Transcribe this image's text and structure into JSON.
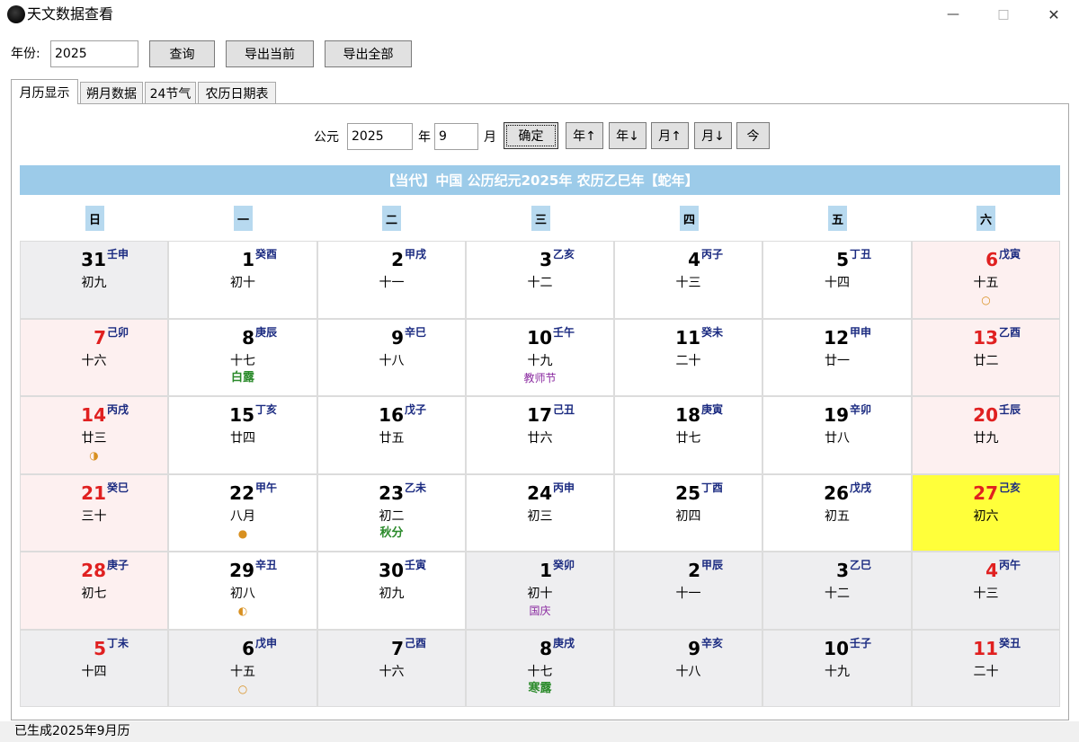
{
  "window": {
    "title": "天文数据查看",
    "minimize": "—",
    "maximize": "□",
    "close": "✕"
  },
  "toolbar": {
    "year_label": "年份:",
    "year_value": "2025",
    "query": "查询",
    "export_current": "导出当前",
    "export_all": "导出全部"
  },
  "tabs": [
    {
      "label": "月历显示",
      "active": true
    },
    {
      "label": "朔月数据",
      "active": false
    },
    {
      "label": "24节气",
      "active": false
    },
    {
      "label": "农历日期表",
      "active": false
    }
  ],
  "nav": {
    "ce_label": "公元",
    "year_value": "2025",
    "year_suffix": "年",
    "month_value": "9",
    "month_suffix": "月",
    "ok": "确定",
    "year_up": "年↑",
    "year_down": "年↓",
    "month_up": "月↑",
    "month_down": "月↓",
    "today": "今"
  },
  "banner": "【当代】中国 公历纪元2025年 农历乙巳年【蛇年】",
  "weekdays": [
    "日",
    "一",
    "二",
    "三",
    "四",
    "五",
    "六"
  ],
  "days": [
    {
      "solar": "31",
      "gz": "壬申",
      "lunar": "初九",
      "extra": "",
      "kind": "othermonth"
    },
    {
      "solar": "1",
      "gz": "癸酉",
      "lunar": "初十",
      "extra": "",
      "kind": "normal"
    },
    {
      "solar": "2",
      "gz": "甲戌",
      "lunar": "十一",
      "extra": "",
      "kind": "normal"
    },
    {
      "solar": "3",
      "gz": "乙亥",
      "lunar": "十二",
      "extra": "",
      "kind": "normal"
    },
    {
      "solar": "4",
      "gz": "丙子",
      "lunar": "十三",
      "extra": "",
      "kind": "normal"
    },
    {
      "solar": "5",
      "gz": "丁丑",
      "lunar": "十四",
      "extra": "",
      "kind": "normal"
    },
    {
      "solar": "6",
      "gz": "戊寅",
      "lunar": "十五",
      "extra": "○",
      "extra_type": "moon",
      "kind": "weekend"
    },
    {
      "solar": "7",
      "gz": "己卯",
      "lunar": "十六",
      "extra": "",
      "kind": "weekend"
    },
    {
      "solar": "8",
      "gz": "庚辰",
      "lunar": "十七",
      "extra": "白露",
      "extra_type": "term",
      "kind": "normal"
    },
    {
      "solar": "9",
      "gz": "辛巳",
      "lunar": "十八",
      "extra": "",
      "kind": "normal"
    },
    {
      "solar": "10",
      "gz": "壬午",
      "lunar": "十九",
      "extra": "教师节",
      "extra_type": "fest",
      "kind": "normal"
    },
    {
      "solar": "11",
      "gz": "癸未",
      "lunar": "二十",
      "extra": "",
      "kind": "normal"
    },
    {
      "solar": "12",
      "gz": "甲申",
      "lunar": "廿一",
      "extra": "",
      "kind": "normal"
    },
    {
      "solar": "13",
      "gz": "乙酉",
      "lunar": "廿二",
      "extra": "",
      "kind": "weekend"
    },
    {
      "solar": "14",
      "gz": "丙戌",
      "lunar": "廿三",
      "extra": "◑",
      "extra_type": "moon",
      "kind": "weekend"
    },
    {
      "solar": "15",
      "gz": "丁亥",
      "lunar": "廿四",
      "extra": "",
      "kind": "normal"
    },
    {
      "solar": "16",
      "gz": "戊子",
      "lunar": "廿五",
      "extra": "",
      "kind": "normal"
    },
    {
      "solar": "17",
      "gz": "己丑",
      "lunar": "廿六",
      "extra": "",
      "kind": "normal"
    },
    {
      "solar": "18",
      "gz": "庚寅",
      "lunar": "廿七",
      "extra": "",
      "kind": "normal"
    },
    {
      "solar": "19",
      "gz": "辛卯",
      "lunar": "廿八",
      "extra": "",
      "kind": "normal"
    },
    {
      "solar": "20",
      "gz": "壬辰",
      "lunar": "廿九",
      "extra": "",
      "kind": "weekend"
    },
    {
      "solar": "21",
      "gz": "癸巳",
      "lunar": "三十",
      "extra": "",
      "kind": "weekend"
    },
    {
      "solar": "22",
      "gz": "甲午",
      "lunar": "八月",
      "extra": "●",
      "extra_type": "moon",
      "kind": "normal"
    },
    {
      "solar": "23",
      "gz": "乙未",
      "lunar": "初二",
      "extra": "秋分",
      "extra_type": "term",
      "kind": "normal"
    },
    {
      "solar": "24",
      "gz": "丙申",
      "lunar": "初三",
      "extra": "",
      "kind": "normal"
    },
    {
      "solar": "25",
      "gz": "丁酉",
      "lunar": "初四",
      "extra": "",
      "kind": "normal"
    },
    {
      "solar": "26",
      "gz": "戊戌",
      "lunar": "初五",
      "extra": "",
      "kind": "normal"
    },
    {
      "solar": "27",
      "gz": "己亥",
      "lunar": "初六",
      "extra": "",
      "kind": "today"
    },
    {
      "solar": "28",
      "gz": "庚子",
      "lunar": "初七",
      "extra": "",
      "kind": "weekend"
    },
    {
      "solar": "29",
      "gz": "辛丑",
      "lunar": "初八",
      "extra": "◐",
      "extra_type": "moon",
      "kind": "normal"
    },
    {
      "solar": "30",
      "gz": "壬寅",
      "lunar": "初九",
      "extra": "",
      "kind": "normal"
    },
    {
      "solar": "1",
      "gz": "癸卯",
      "lunar": "初十",
      "extra": "国庆",
      "extra_type": "fest",
      "kind": "othermonth"
    },
    {
      "solar": "2",
      "gz": "甲辰",
      "lunar": "十一",
      "extra": "",
      "kind": "othermonth"
    },
    {
      "solar": "3",
      "gz": "乙巳",
      "lunar": "十二",
      "extra": "",
      "kind": "othermonth"
    },
    {
      "solar": "4",
      "gz": "丙午",
      "lunar": "十三",
      "extra": "",
      "kind": "othermonth",
      "red": true
    },
    {
      "solar": "5",
      "gz": "丁未",
      "lunar": "十四",
      "extra": "",
      "kind": "othermonth",
      "red": true
    },
    {
      "solar": "6",
      "gz": "戊申",
      "lunar": "十五",
      "extra": "○",
      "extra_type": "moon",
      "kind": "othermonth"
    },
    {
      "solar": "7",
      "gz": "己酉",
      "lunar": "十六",
      "extra": "",
      "kind": "othermonth"
    },
    {
      "solar": "8",
      "gz": "庚戌",
      "lunar": "十七",
      "extra": "寒露",
      "extra_type": "term",
      "kind": "othermonth"
    },
    {
      "solar": "9",
      "gz": "辛亥",
      "lunar": "十八",
      "extra": "",
      "kind": "othermonth"
    },
    {
      "solar": "10",
      "gz": "壬子",
      "lunar": "十九",
      "extra": "",
      "kind": "othermonth"
    },
    {
      "solar": "11",
      "gz": "癸丑",
      "lunar": "二十",
      "extra": "",
      "kind": "othermonth",
      "red": true
    }
  ],
  "status": "已生成2025年9月历"
}
